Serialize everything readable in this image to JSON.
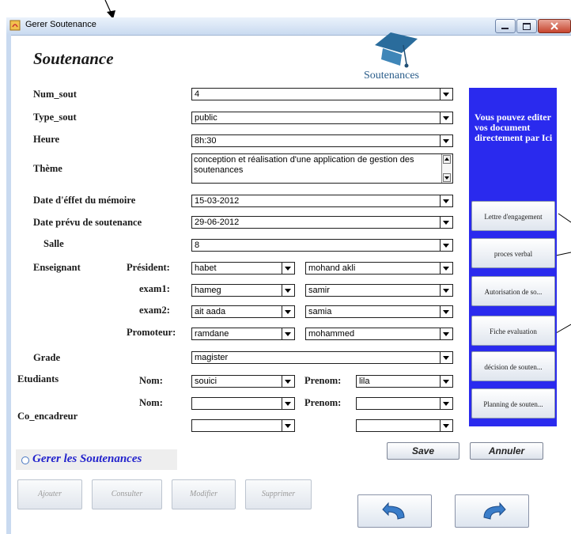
{
  "window": {
    "title": "Gerer Soutenance"
  },
  "header": {
    "title": "Soutenance",
    "logo_caption": "Soutenances"
  },
  "form": {
    "num_sout": {
      "label": "Num_sout",
      "value": "4"
    },
    "type_sout": {
      "label": "Type_sout",
      "value": "public"
    },
    "heure": {
      "label": "Heure",
      "value": "8h:30"
    },
    "theme": {
      "label": "Thème",
      "value": "conception et réalisation d'une application de gestion des soutenances"
    },
    "date_effet": {
      "label": "Date d'éffet du mémoire",
      "value": "15-03-2012"
    },
    "date_prevu": {
      "label": "Date prévu de soutenance",
      "value": "29-06-2012"
    },
    "salle": {
      "label": "Salle",
      "value": "8"
    },
    "enseignant": {
      "label": "Enseignant",
      "rows": [
        {
          "role": "Président:",
          "nom": "habet",
          "prenom": "mohand akli"
        },
        {
          "role": "exam1:",
          "nom": "hameg",
          "prenom": "samir"
        },
        {
          "role": "exam2:",
          "nom": "ait aada",
          "prenom": "samia"
        },
        {
          "role": "Promoteur:",
          "nom": "ramdane",
          "prenom": "mohammed"
        }
      ]
    },
    "grade": {
      "label": "Grade",
      "value": "magister"
    },
    "etudiants": {
      "label": "Etudiants",
      "nom_label": "Nom:",
      "prenom_label": "Prenom:",
      "rows": [
        {
          "nom": "souici",
          "prenom": "lila"
        },
        {
          "nom": "",
          "prenom": ""
        }
      ]
    },
    "co_encadreur": {
      "label": "Co_encadreur",
      "nom": "",
      "prenom": ""
    }
  },
  "side_panel": {
    "note": "Vous pouvez editer vos document directement par Ici",
    "buttons": [
      "Lettre d'engagement",
      "proces verbal",
      "Autorisation de so...",
      "Fiche evaluation",
      "décision de souten...",
      "Planning de souten..."
    ]
  },
  "actions": {
    "save": "Save",
    "cancel": "Annuler"
  },
  "manage": {
    "title": "Gerer les Soutenances",
    "buttons": [
      "Ajouter",
      "Consulter",
      "Modifier",
      "Supprimer"
    ]
  },
  "colors": {
    "panel_blue": "#2a2aee",
    "manage_title": "#2222cc"
  },
  "icons": {
    "undo": "undo-arrow-icon",
    "redo": "redo-arrow-icon",
    "logo": "graduation-cap-icon"
  }
}
